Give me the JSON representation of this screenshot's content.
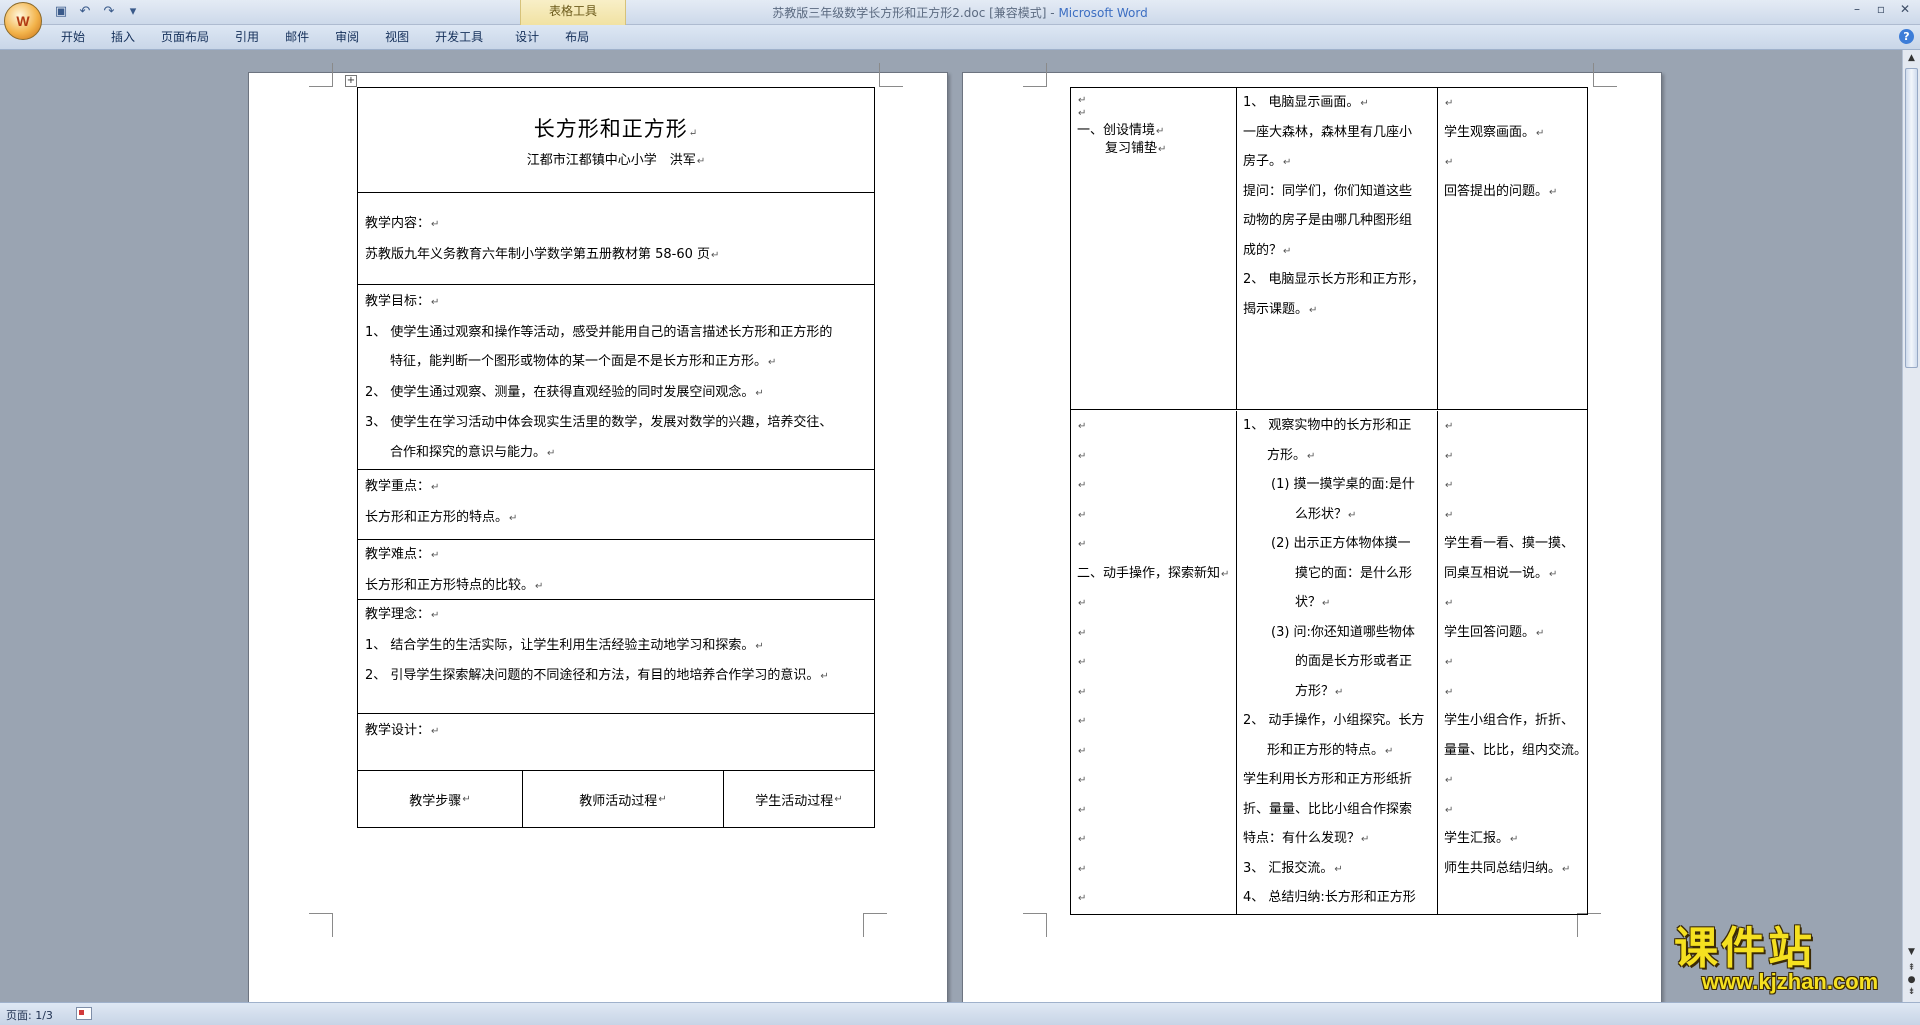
{
  "window": {
    "title_doc": "苏教版三年级数学长方形和正方形2.doc [兼容模式] - ",
    "title_app": "Microsoft Word",
    "contextual_group": "表格工具"
  },
  "icons": {
    "office": "office-button-icon",
    "save": "save-icon",
    "undo": "undo-icon",
    "redo": "redo-icon",
    "customize": "customize-qat-icon",
    "minimize": "minimize-icon",
    "maximize": "maximize-icon",
    "close": "close-icon",
    "help": "help-icon"
  },
  "ribbon": {
    "tabs": [
      "开始",
      "插入",
      "页面布局",
      "引用",
      "邮件",
      "审阅",
      "视图",
      "开发工具",
      "设计",
      "布局"
    ]
  },
  "page1": {
    "title": "长方形和正方形",
    "subtitle": "江都市江都镇中心小学　洪军",
    "content_label": "教学内容：",
    "content_text": "苏教版九年义务教育六年制小学数学第五册教材第 58-60 页",
    "goals_label": "教学目标：",
    "goal1a": "1、 使学生通过观察和操作等活动，感受并能用自己的语言描述长方形和正方形的",
    "goal1b": "特征，能判断一个图形或物体的某一个面是不是长方形和正方形。",
    "goal2": "2、 使学生通过观察、测量，在获得直观经验的同时发展空间观念。",
    "goal3a": "3、 使学生在学习活动中体会现实生活里的数学，发展对数学的兴趣，培养交往、",
    "goal3b": "合作和探究的意识与能力。",
    "key_label": "教学重点：",
    "key_text": "长方形和正方形的特点。",
    "hard_label": "教学难点：",
    "hard_text": "长方形和正方形特点的比较。",
    "idea_label": "教学理念：",
    "idea1": "1、 结合学生的生活实际，让学生利用生活经验主动地学习和探索。",
    "idea2": "2、 引导学生探索解决问题的不同途径和方法，有目的地培养合作学习的意识。",
    "design_label": "教学设计：",
    "col_steps": "教学步骤",
    "col_teacher": "教师活动过程",
    "col_student": "学生活动过程"
  },
  "page2": {
    "r1_step_a": "一、创设情境",
    "r1_step_b": "复习铺垫",
    "r1_t1": "1、 电脑显示画面。",
    "r1_t2": "一座大森林，森林里有几座小",
    "r1_t3": "房子。",
    "r1_t4": "提问：同学们，你们知道这些",
    "r1_t5": "动物的房子是由哪几种图形组",
    "r1_t6": "成的？",
    "r1_t7": "2、 电脑显示长方形和正方形，",
    "r1_t8": "揭示课题。",
    "r1_s1": "学生观察画面。",
    "r1_s2": "回答提出的问题。",
    "r2_step": "二、动手操作，探索新知",
    "r2_t1": "1、 观察实物中的长方形和正",
    "r2_t2": "方形。",
    "r2_t3": "(1)  摸一摸学桌的面:是什",
    "r2_t4": "么形状？",
    "r2_t5": "(2)  出示正方体物体摸一",
    "r2_t6": "摸它的面：是什么形",
    "r2_t7": "状？",
    "r2_t8": "(3)  问:你还知道哪些物体",
    "r2_t9": "的面是长方形或者正",
    "r2_t10": "方形？",
    "r2_t11": "2、 动手操作，小组探究。长方",
    "r2_t12": "形和正方形的特点。",
    "r2_t13": "学生利用长方形和正方形纸折",
    "r2_t14": "折、量量、比比小组合作探索",
    "r2_t15": "特点：有什么发现？",
    "r2_t16": "3、 汇报交流。",
    "r2_t17": "4、 总结归纳:长方形和正方形",
    "r2_s1": "学生看一看、摸一摸、",
    "r2_s2": "同桌互相说一说。",
    "r2_s3": "学生回答问题。",
    "r2_s4": "学生小组合作，折折、",
    "r2_s5": "量量、比比，组内交流。",
    "r2_s6": "学生汇报。",
    "r2_s7": "师生共同总结归纳。"
  },
  "status": {
    "page": "页面: 1/3"
  },
  "watermark": {
    "top": "课件站",
    "bottom": "www.kjzhan.com"
  },
  "colors": {
    "accent": "#3c6ec2",
    "contextual": "#f1e2a3",
    "watermark": "#f5e020"
  }
}
